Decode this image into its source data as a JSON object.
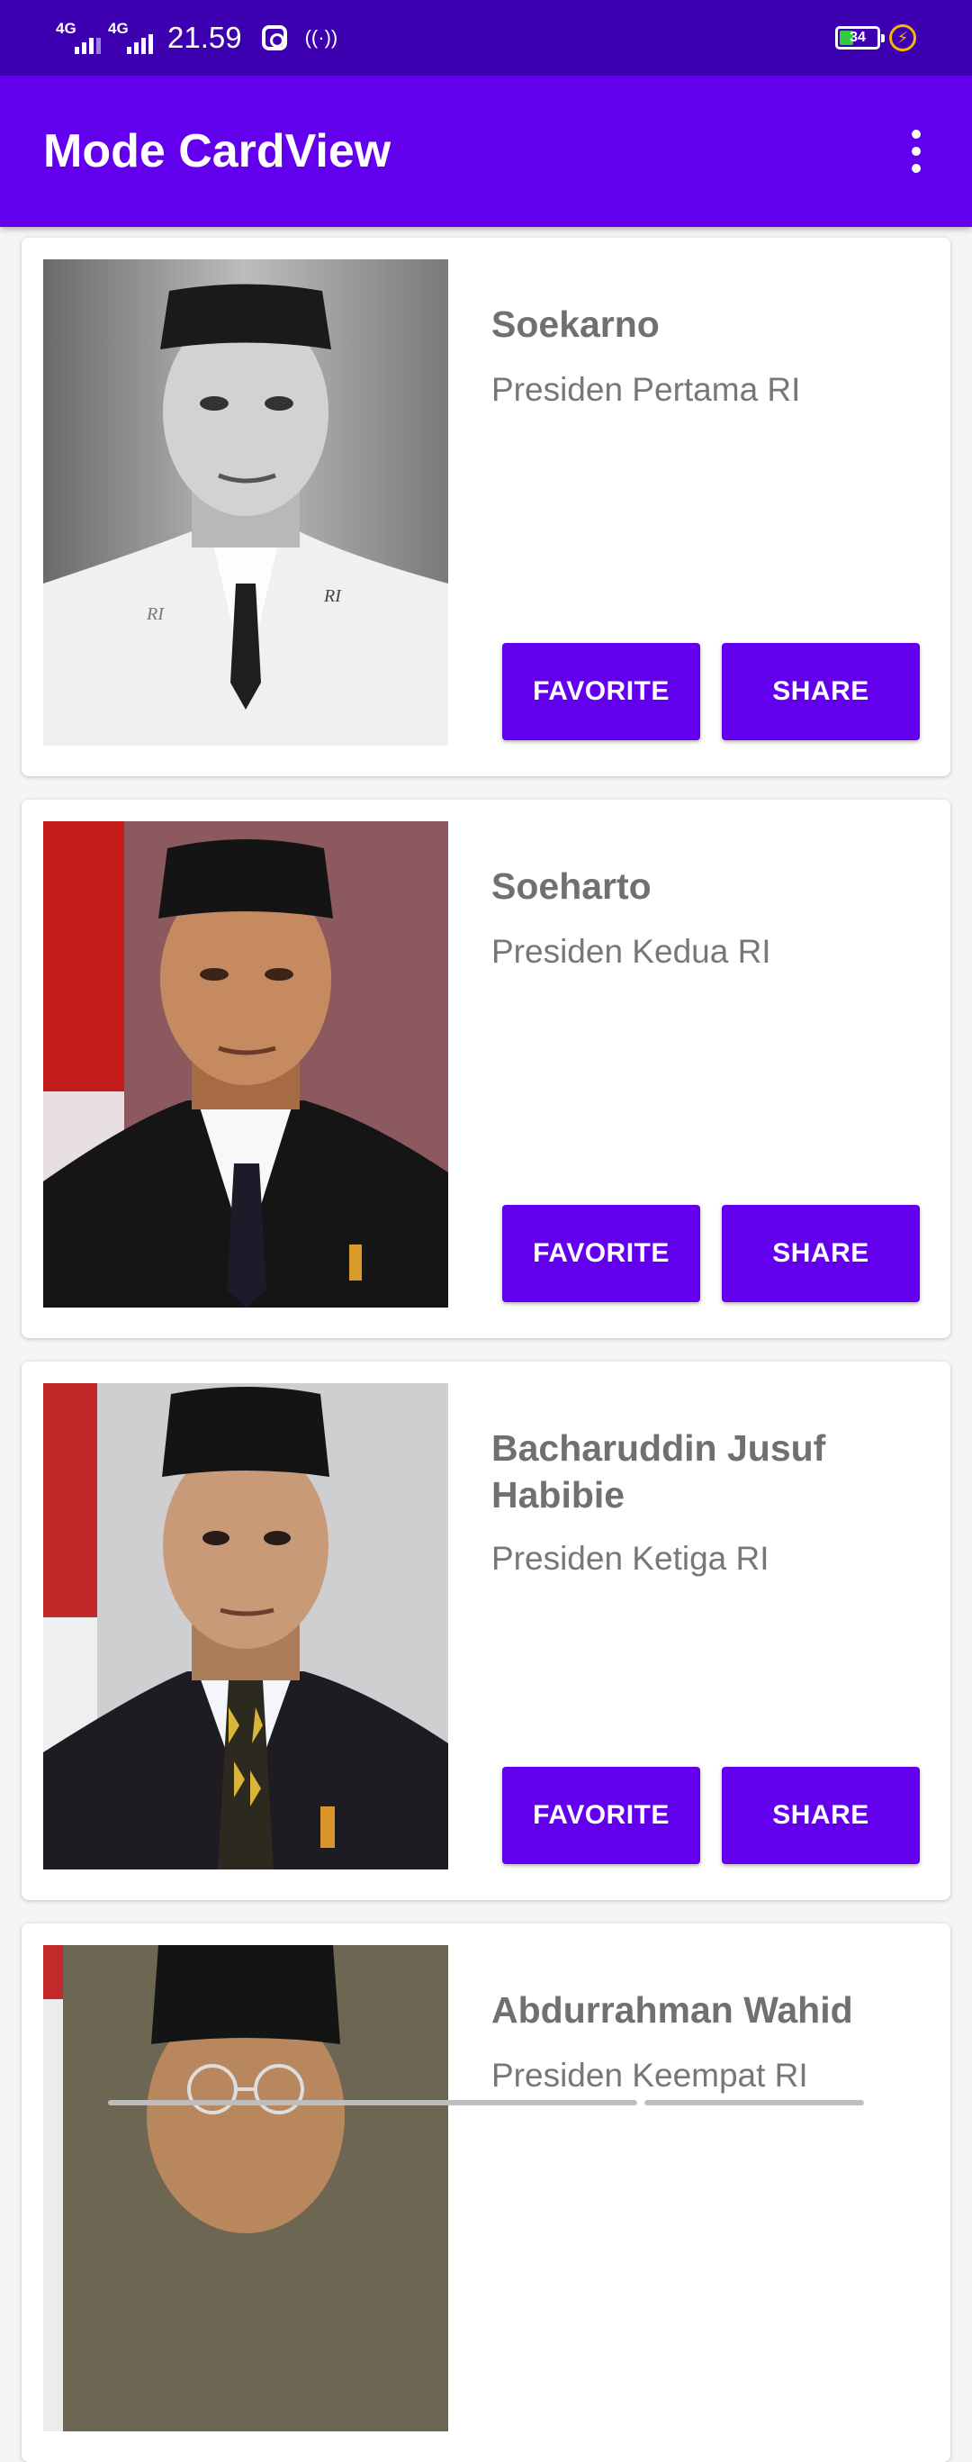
{
  "status_bar": {
    "net1": "4G",
    "net2": "4G",
    "time": "21.59",
    "battery_percent": "34",
    "battery_level": 0.34
  },
  "app_bar": {
    "title": "Mode CardView",
    "menu_icon": "more-vert-icon"
  },
  "colors": {
    "primary": "#6200ee",
    "primary_dark": "#3d00b0"
  },
  "cards": [
    {
      "name": "Soekarno",
      "subtitle": "Presiden Pertama RI",
      "favorite_label": "FAVORITE",
      "share_label": "SHARE"
    },
    {
      "name": "Soeharto",
      "subtitle": "Presiden Kedua RI",
      "favorite_label": "FAVORITE",
      "share_label": "SHARE"
    },
    {
      "name": "Bacharuddin Jusuf Habibie",
      "subtitle": "Presiden Ketiga RI",
      "favorite_label": "FAVORITE",
      "share_label": "SHARE"
    },
    {
      "name": "Abdurrahman Wahid",
      "subtitle": "Presiden Keempat RI"
    }
  ]
}
